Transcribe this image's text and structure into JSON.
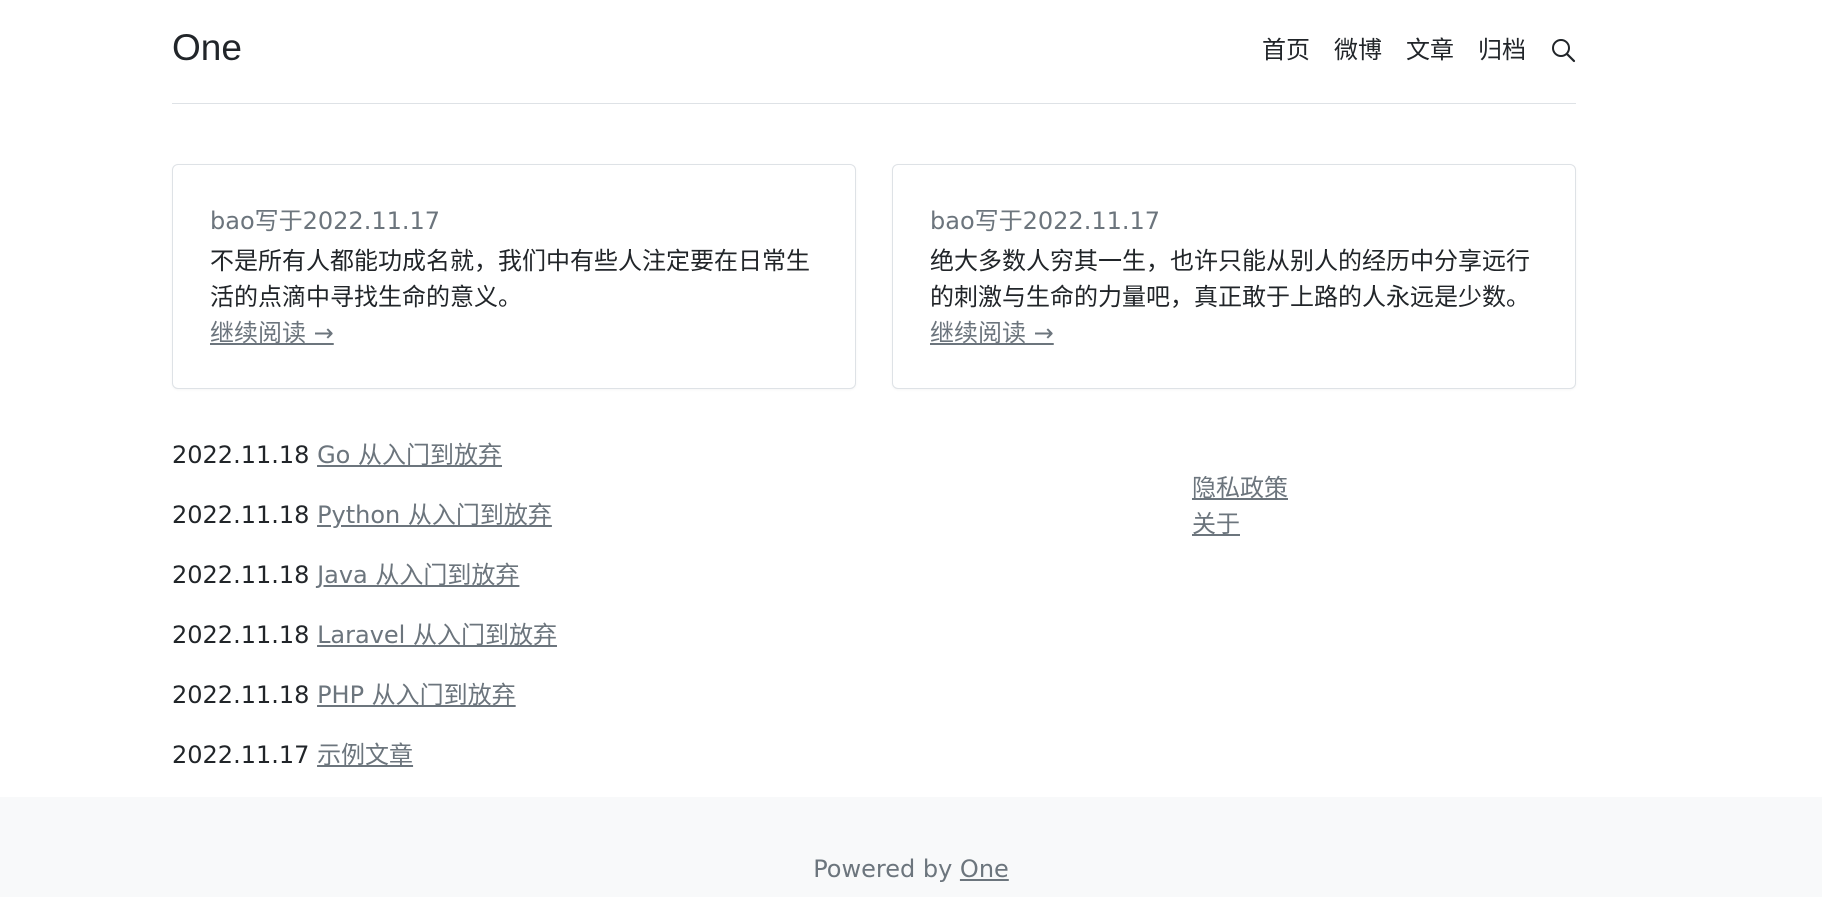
{
  "header": {
    "logo": "One",
    "nav": [
      "首页",
      "微博",
      "文章",
      "归档"
    ],
    "search_icon": "search-icon"
  },
  "cards": [
    {
      "meta": "bao写于2022.11.17",
      "text": "不是所有人都能功成名就，我们中有些人注定要在日常生活的点滴中寻找生命的意义。",
      "more": "继续阅读 →"
    },
    {
      "meta": "bao写于2022.11.17",
      "text": "绝大多数人穷其一生，也许只能从别人的经历中分享远行的刺激与生命的力量吧，真正敢于上路的人永远是少数。",
      "more": "继续阅读 →"
    }
  ],
  "posts": [
    {
      "date": "2022.11.18",
      "title": "Go 从入门到放弃"
    },
    {
      "date": "2022.11.18",
      "title": "Python 从入门到放弃"
    },
    {
      "date": "2022.11.18",
      "title": "Java 从入门到放弃"
    },
    {
      "date": "2022.11.18",
      "title": "Laravel 从入门到放弃"
    },
    {
      "date": "2022.11.18",
      "title": "PHP 从入门到放弃"
    },
    {
      "date": "2022.11.17",
      "title": "示例文章"
    }
  ],
  "side_links": [
    "隐私政策",
    "关于"
  ],
  "footer": {
    "prefix": "Powered by ",
    "link": "One"
  }
}
